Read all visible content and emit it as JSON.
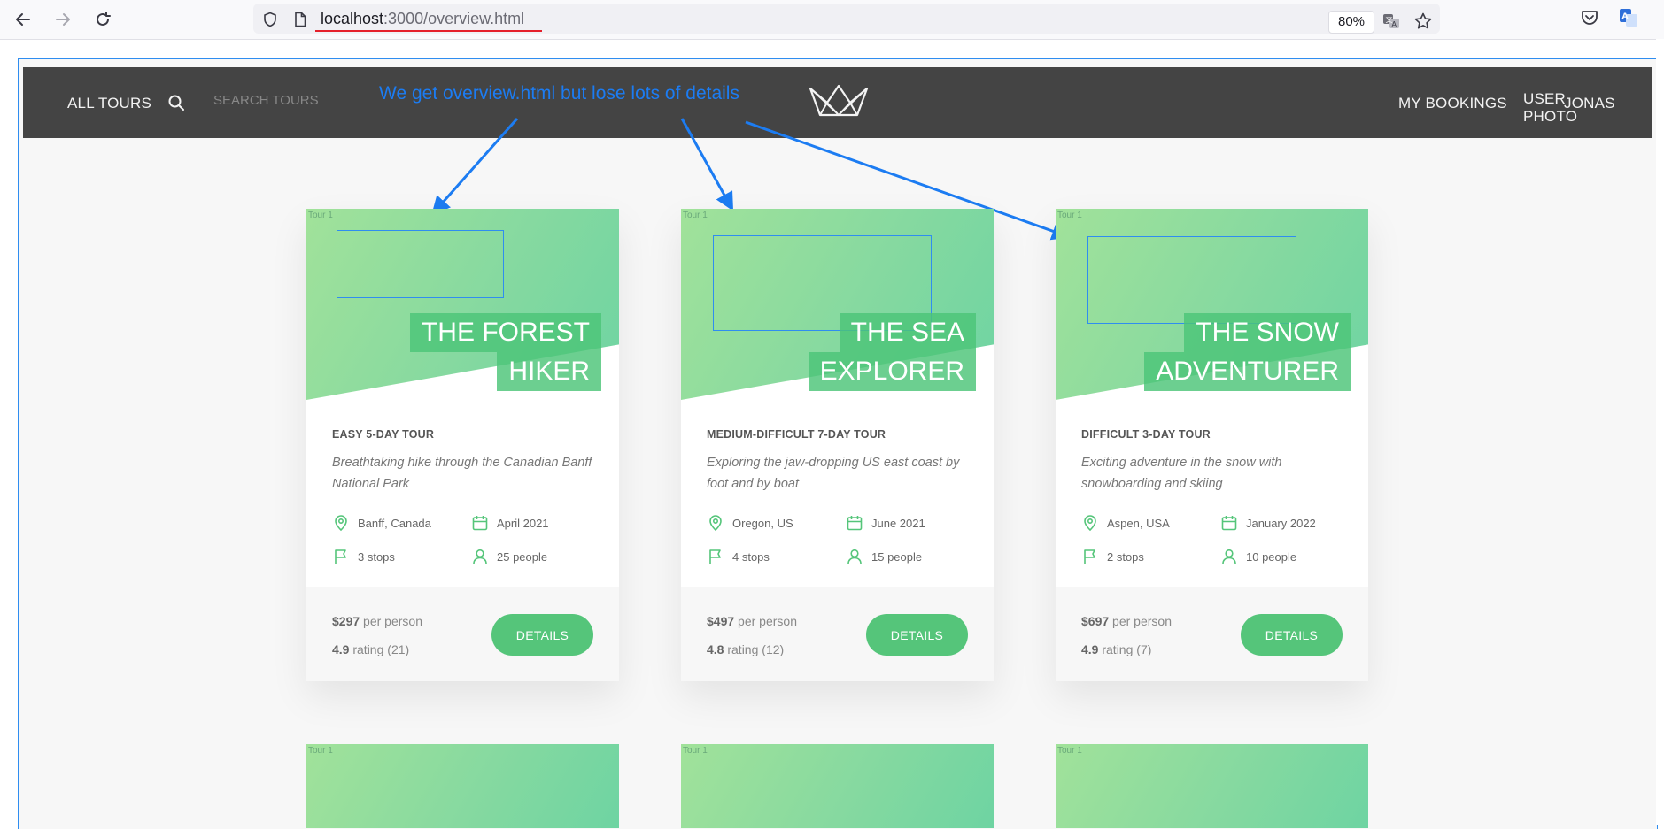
{
  "browser": {
    "url_host": "localhost",
    "url_rest": ":3000/overview.html",
    "zoom": "80%"
  },
  "header": {
    "all_tours": "ALL TOURS",
    "search_placeholder": "SEARCH TOURS",
    "my_bookings": "MY BOOKINGS",
    "user_photo_line1": "USER",
    "user_photo_line2": "PHOTO",
    "user_name": "JONAS"
  },
  "annotation": "We get overview.html but lose lots of details",
  "tour_tag": "Tour 1",
  "details_label": "DETAILS",
  "per_person": "per person",
  "rating_word": "rating",
  "colors": {
    "accent": "#55c57a",
    "header": "#444444",
    "annotation": "#1c7cf2"
  },
  "tours": [
    {
      "title_line1": "THE FOREST",
      "title_line2": "HIKER",
      "subheading": "EASY 5-DAY TOUR",
      "description": "Breathtaking hike through the Canadian Banff National Park",
      "location": "Banff, Canada",
      "date": "April 2021",
      "stops": "3 stops",
      "people": "25 people",
      "price": "$297",
      "rating": "4.9",
      "rating_count": "(21)"
    },
    {
      "title_line1": "THE SEA",
      "title_line2": "EXPLORER",
      "subheading": "MEDIUM-DIFFICULT 7-DAY TOUR",
      "description": "Exploring the jaw-dropping US east coast by foot and by boat",
      "location": "Oregon, US",
      "date": "June 2021",
      "stops": "4 stops",
      "people": "15 people",
      "price": "$497",
      "rating": "4.8",
      "rating_count": "(12)"
    },
    {
      "title_line1": "THE SNOW",
      "title_line2": "ADVENTURER",
      "subheading": "DIFFICULT 3-DAY TOUR",
      "description": "Exciting adventure in the snow with snowboarding and skiing",
      "location": "Aspen, USA",
      "date": "January 2022",
      "stops": "2 stops",
      "people": "10 people",
      "price": "$697",
      "rating": "4.9",
      "rating_count": "(7)"
    }
  ]
}
